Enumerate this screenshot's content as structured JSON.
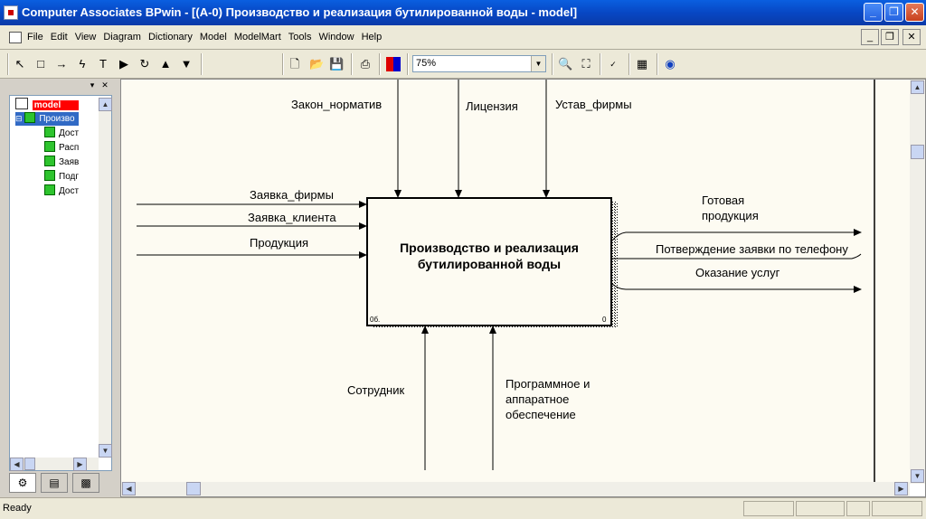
{
  "window": {
    "title": "Computer Associates BPwin - [(A-0) Производство и реализация  бутилированной воды  - model]",
    "minimize": "_",
    "maximize": "❐",
    "close": "✕"
  },
  "menu": {
    "items": [
      "File",
      "Edit",
      "View",
      "Diagram",
      "Dictionary",
      "Model",
      "ModelMart",
      "Tools",
      "Window",
      "Help"
    ],
    "mdi_minimize": "_",
    "mdi_restore": "❐",
    "mdi_close": "✕"
  },
  "toolbar": {
    "zoom_value": "75%",
    "icons": [
      "pointer-icon",
      "box-icon",
      "arrow-icon",
      "squiggle-icon",
      "text-icon",
      "triangle-right-icon",
      "rotate-icon",
      "triangle-up-icon",
      "triangle-down-icon",
      "new-icon",
      "open-icon",
      "save-icon",
      "print-icon",
      "color-icon",
      "zoom-in-icon",
      "zoom-fit-icon",
      "spell-check-icon",
      "model-explorer-icon",
      "globe-icon"
    ]
  },
  "tree": {
    "root": "model",
    "activity": "Произво",
    "children": [
      "Дост",
      "Расп",
      "Заяв",
      "Подг",
      "Дост"
    ]
  },
  "diagram": {
    "box_title_line1": "Производство и реализация",
    "box_title_line2": "бутилированной воды",
    "box_corner_left": "0б.",
    "box_corner_right": "0",
    "controls": [
      "Закон_норматив",
      "Лицензия",
      "Устав_фирмы"
    ],
    "inputs": [
      "Заявка_фирмы",
      "Заявка_клиента",
      "Продукция"
    ],
    "outputs": {
      "o1_line1": "Готовая",
      "o1_line2": "продукция",
      "o2": "Потверждение заявки по телефону",
      "o3": "Оказание услуг"
    },
    "mechanisms": {
      "m1": "Сотрудник",
      "m2_line1": "Программное и",
      "m2_line2": "аппаратное",
      "m2_line3": "обеспечение"
    }
  },
  "status": {
    "text": "Ready"
  }
}
